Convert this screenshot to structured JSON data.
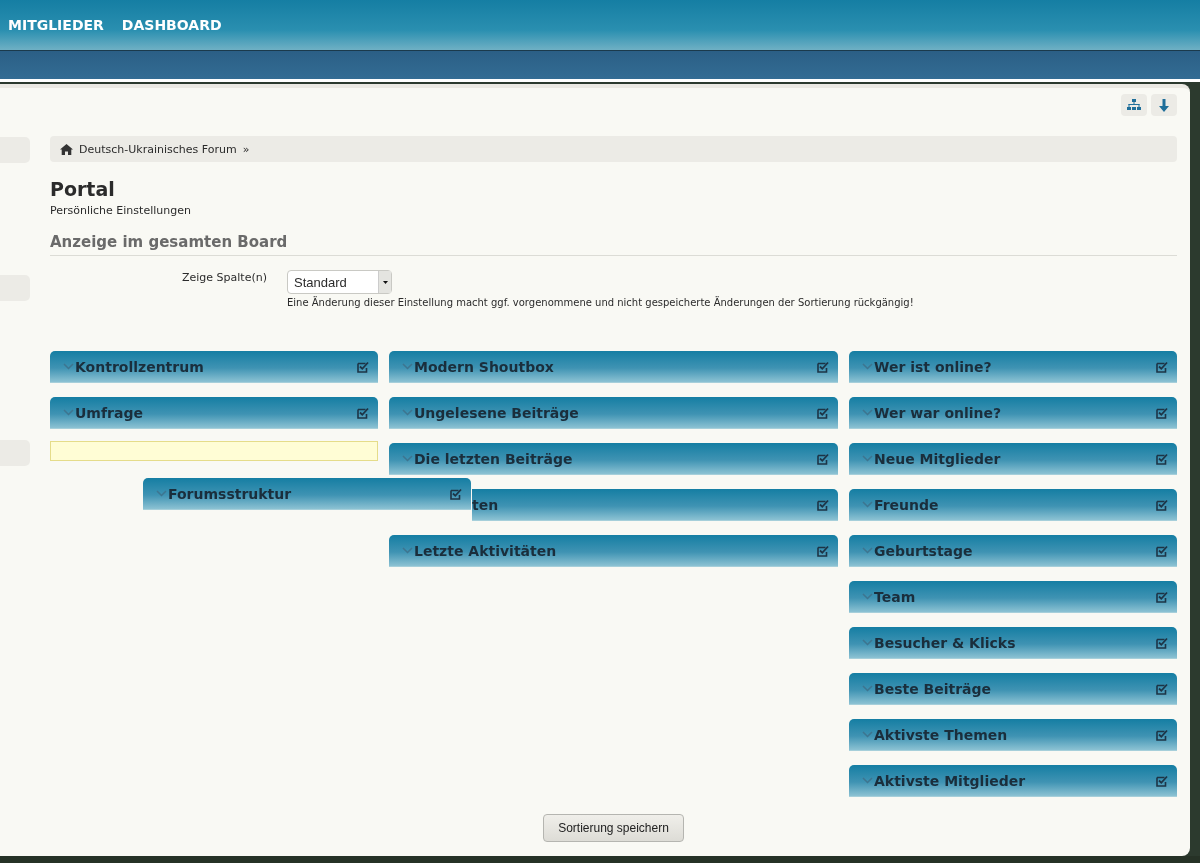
{
  "nav": [
    {
      "label": "MITGLIEDER"
    },
    {
      "label": "DASHBOARD"
    }
  ],
  "breadcrumb": {
    "label": "Deutsch-Ukrainisches Forum",
    "separator": "»"
  },
  "page": {
    "title": "Portal",
    "subtitle": "Persönliche Einstellungen"
  },
  "section": {
    "title": "Anzeige im gesamten Board"
  },
  "setting": {
    "label": "Zeige Spalte(n)",
    "value": "Standard",
    "description": "Eine Änderung dieser Einstellung macht ggf. vorgenommene und nicht gespeicherte Änderungen der Sortierung rückgängig!"
  },
  "columns": [
    {
      "boxes": [
        {
          "title": "Kontrollzentrum",
          "checked": true
        },
        {
          "title": "Umfrage",
          "checked": true
        },
        {
          "kind": "placeholder"
        }
      ]
    },
    {
      "boxes": [
        {
          "title": "Modern Shoutbox",
          "checked": true
        },
        {
          "title": "Ungelesene Beiträge",
          "checked": true
        },
        {
          "title": "Die letzten Beiträge",
          "checked": true
        },
        {
          "title": "ten",
          "checked": true,
          "covered": true
        },
        {
          "title": "Letzte Aktivitäten",
          "checked": true
        }
      ]
    },
    {
      "boxes": [
        {
          "title": "Wer ist online?",
          "checked": true
        },
        {
          "title": "Wer war online?",
          "checked": true
        },
        {
          "title": "Neue Mitglieder",
          "checked": true
        },
        {
          "title": "Freunde",
          "checked": true
        },
        {
          "title": "Geburtstage",
          "checked": true
        },
        {
          "title": "Team",
          "checked": true
        },
        {
          "title": "Besucher & Klicks",
          "checked": true
        },
        {
          "title": "Beste Beiträge",
          "checked": true
        },
        {
          "title": "Aktivste Themen",
          "checked": true
        },
        {
          "title": "Aktivste Mitglieder",
          "checked": true
        }
      ]
    }
  ],
  "dragging": {
    "title": "Forumsstruktur",
    "checked": true
  },
  "save_button": {
    "label": "Sortierung speichern"
  }
}
